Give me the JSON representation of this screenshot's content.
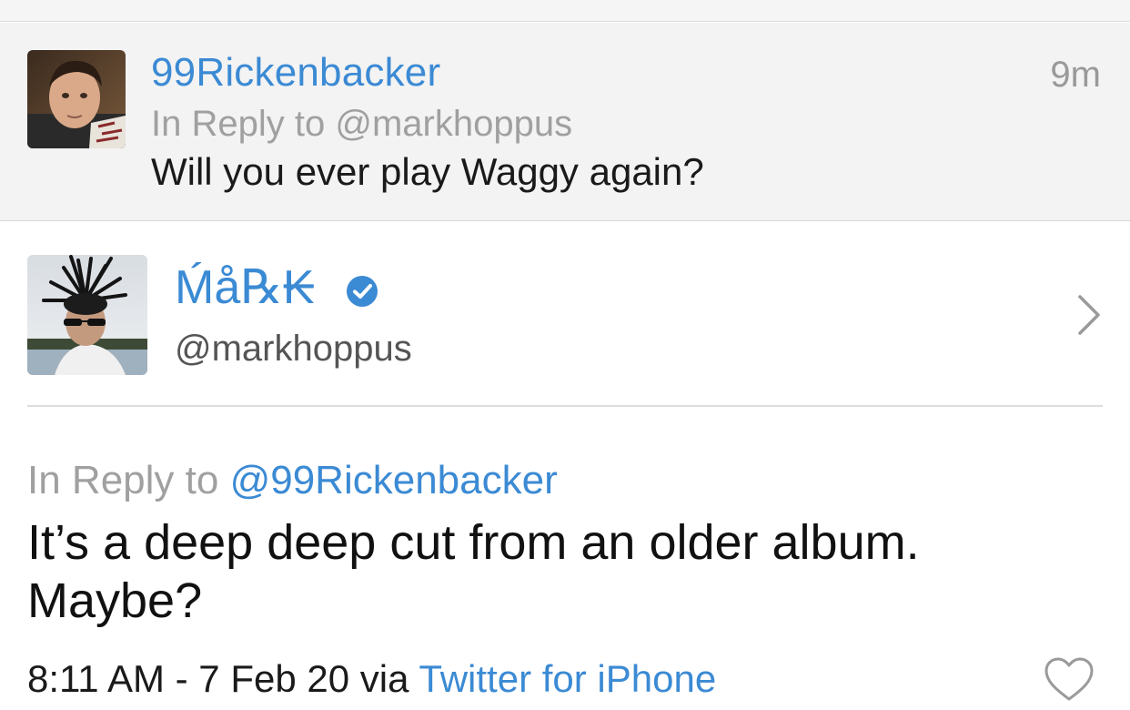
{
  "parent_tweet": {
    "username": "99Rickenbacker",
    "time": "9m",
    "reply_prefix": "In Reply to",
    "reply_handle": "@markhoppus",
    "text": "Will you ever play Waggy again?"
  },
  "author": {
    "display_name": "Ḿå℞₭",
    "handle": "@markhoppus",
    "verified": true,
    "badge_icon": "verified-badge-icon",
    "chevron_icon": "chevron-right-icon"
  },
  "tweet": {
    "reply_prefix": "In Reply to",
    "reply_handle": "@99Rickenbacker",
    "text": "It’s a deep deep cut from an older album. Maybe?",
    "timestamp": "8:11 AM - 7 Feb 20 via",
    "source": "Twitter for iPhone",
    "like_icon": "heart-icon"
  },
  "colors": {
    "link_blue": "#3b8ad4",
    "muted_gray": "#a0a0a0",
    "parent_background": "#f3f3f3"
  }
}
